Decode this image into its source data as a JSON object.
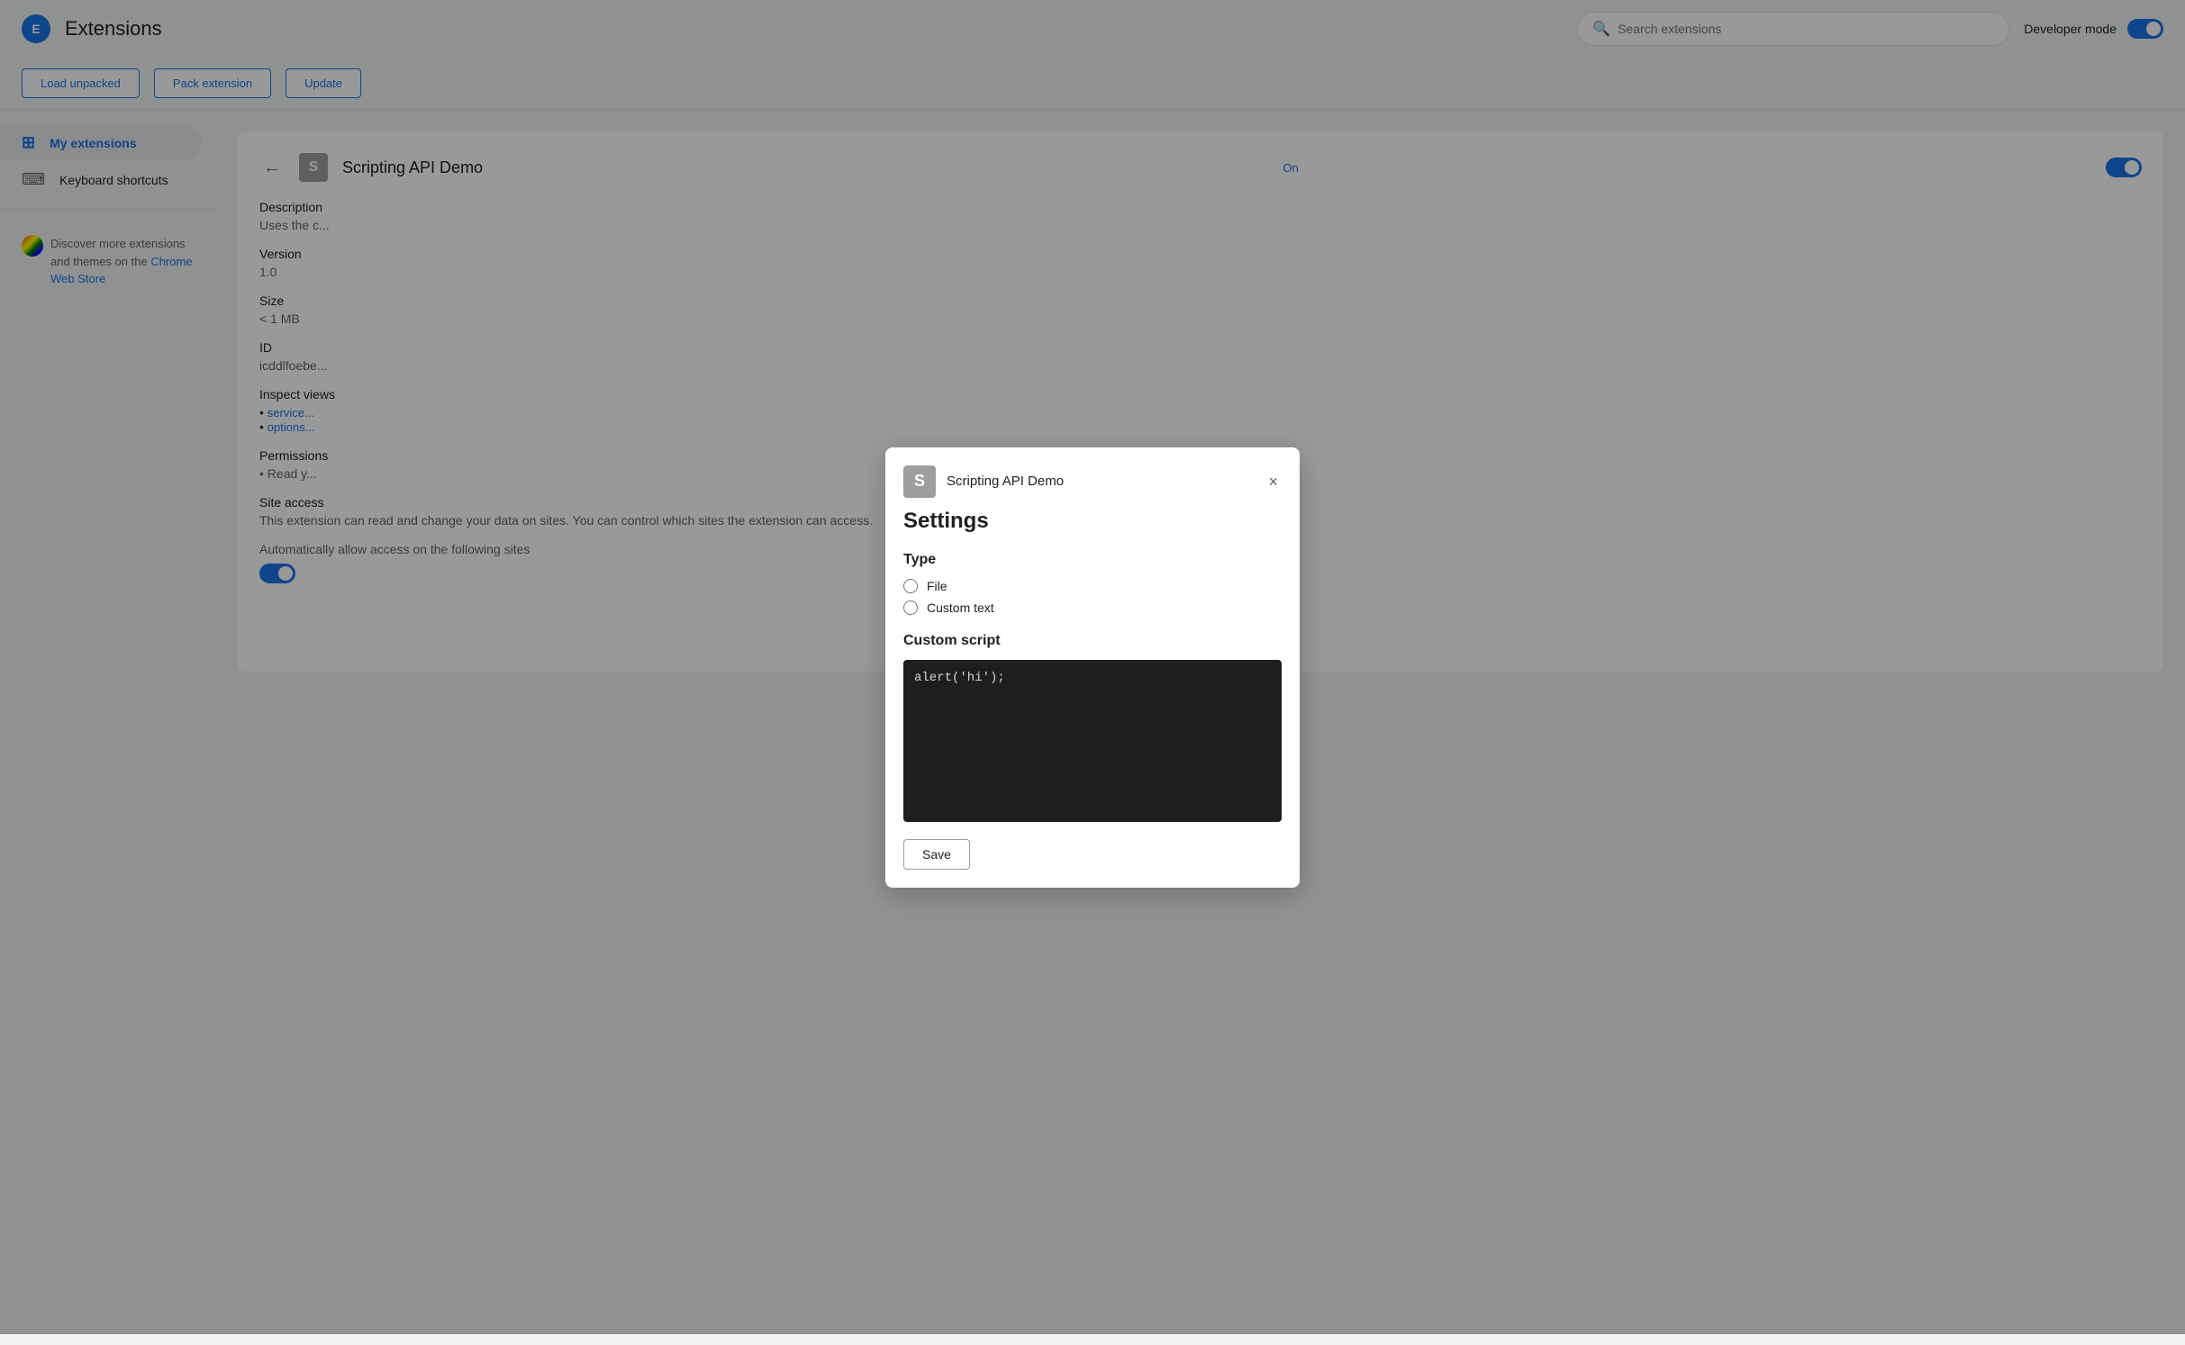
{
  "header": {
    "logo_text": "E",
    "title": "Extensions",
    "search_placeholder": "Search extensions",
    "dev_mode_label": "Developer mode",
    "toggle_on": true
  },
  "toolbar": {
    "load_unpacked_label": "Load unpacked",
    "pack_extension_label": "Pack extension",
    "update_label": "Update"
  },
  "sidebar": {
    "items": [
      {
        "id": "my-extensions",
        "label": "My extensions",
        "icon": "⊞",
        "active": true
      },
      {
        "id": "keyboard-shortcuts",
        "label": "Keyboard shortcuts",
        "icon": "⌨",
        "active": false
      }
    ],
    "discover_text": "Discover more extensions and themes on the ",
    "discover_link_text": "Chrome Web Store",
    "discover_link_href": "#"
  },
  "detail": {
    "extension_name": "Scripting API Demo",
    "icon_letter": "S",
    "on_label": "On",
    "toggle_on": true,
    "description_label": "Description",
    "description_value": "Uses the c...",
    "version_label": "Version",
    "version_value": "1.0",
    "size_label": "Size",
    "size_value": "< 1 MB",
    "id_label": "ID",
    "id_value": "icddlfoebe...",
    "inspect_views_label": "Inspect views",
    "service_worker_link": "service...",
    "options_link": "options...",
    "permissions_label": "Permissions",
    "permissions_value": "Read y...",
    "site_access_label": "Site access",
    "site_access_description": "This extension can read and change your data on sites. You can control which sites the extension can access.",
    "auto_allow_label": "Automatically allow access on the following sites",
    "auto_allow_toggle": true
  },
  "dialog": {
    "ext_icon_letter": "S",
    "ext_name": "Scripting API Demo",
    "close_label": "×",
    "title": "Settings",
    "type_section_title": "Type",
    "type_options": [
      {
        "id": "file",
        "label": "File",
        "checked": false
      },
      {
        "id": "custom-text",
        "label": "Custom text",
        "checked": false
      }
    ],
    "custom_script_title": "Custom script",
    "code_content": "alert('hi');",
    "save_button_label": "Save"
  },
  "colors": {
    "accent": "#1a73e8",
    "sidebar_active_bg": "#e8eaed",
    "toggle_on": "#1a73e8",
    "code_bg": "#1e1e1e"
  }
}
